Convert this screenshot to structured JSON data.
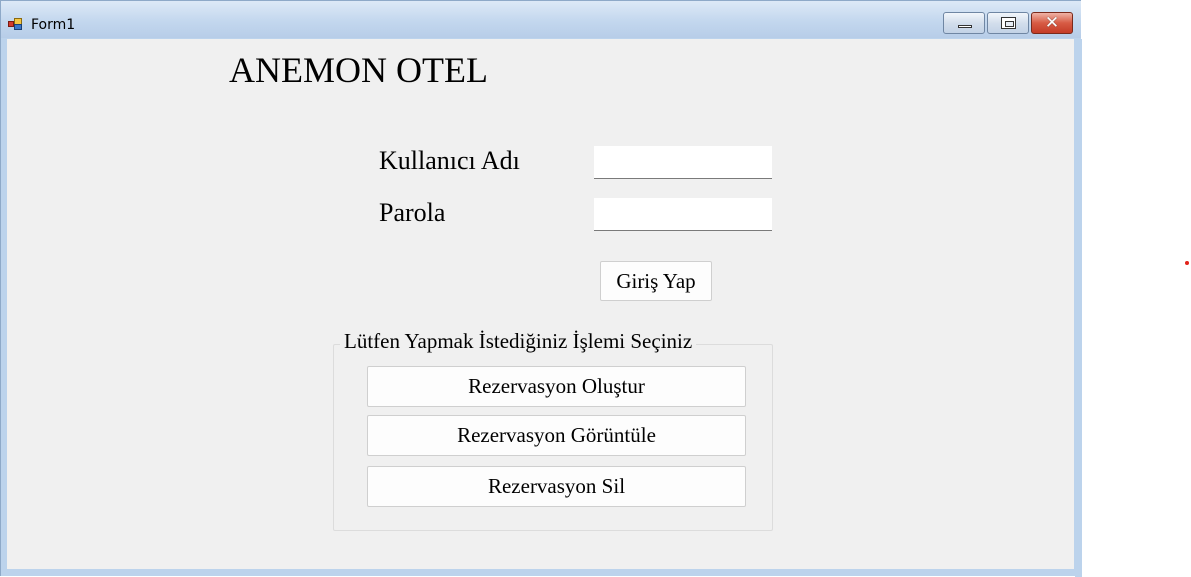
{
  "window": {
    "title": "Form1",
    "icon": "form-app-icon",
    "controls": {
      "minimize": "minimize-icon",
      "maximize": "maximize-icon",
      "close": "close-icon"
    }
  },
  "form": {
    "heading": "ANEMON OTEL",
    "username_label": "Kullanıcı Adı",
    "username_value": "",
    "password_label": "Parola",
    "password_value": "",
    "login_button": "Giriş Yap"
  },
  "operations": {
    "legend": "Lütfen Yapmak İstediğiniz İşlemi Seçiniz",
    "buttons": [
      "Rezervasyon Oluştur",
      "Rezervasyon Görüntüle",
      "Rezervasyon Sil"
    ]
  },
  "colors": {
    "client_bg": "#f0f0f0",
    "titlebar": "#c3d7ee",
    "close_button": "#d75b44"
  }
}
